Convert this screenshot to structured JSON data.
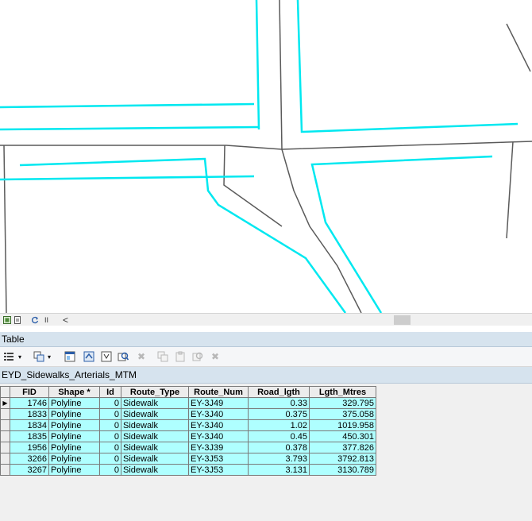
{
  "window": {
    "table_title": "Table",
    "tab_label": "EYD_Sidewalks_Arterials_MTM"
  },
  "map_bar": {
    "icons": [
      "layout-view-icon",
      "data-view-icon",
      "refresh-icon",
      "pause-icon",
      "scroll-left-icon"
    ],
    "pause_glyph": "II",
    "scroll_left_glyph": "<"
  },
  "toolbar": {
    "icons": [
      "table-options-icon",
      "related-tables-icon",
      "select-by-attributes-icon",
      "switch-selection-icon",
      "clear-selection-icon",
      "zoom-to-selected-icon",
      "delete-selected-icon",
      "copy-icon",
      "paste-icon",
      "zoom-icon",
      "delete-icon"
    ]
  },
  "colors": {
    "sidewalk": "#00e8f0",
    "road": "#555555",
    "row_bg": "#afffff",
    "header_bg": "#d6e3ee"
  },
  "table": {
    "columns": [
      "FID",
      "Shape *",
      "Id",
      "Route_Type",
      "Route_Num",
      "Road_lgth",
      "Lgth_Mtres"
    ],
    "rows": [
      [
        "1746",
        "Polyline",
        "0",
        "Sidewalk",
        "EY-3J49",
        "0.33",
        "329.795"
      ],
      [
        "1833",
        "Polyline",
        "0",
        "Sidewalk",
        "EY-3J40",
        "0.375",
        "375.058"
      ],
      [
        "1834",
        "Polyline",
        "0",
        "Sidewalk",
        "EY-3J40",
        "1.02",
        "1019.958"
      ],
      [
        "1835",
        "Polyline",
        "0",
        "Sidewalk",
        "EY-3J40",
        "0.45",
        "450.301"
      ],
      [
        "1956",
        "Polyline",
        "0",
        "Sidewalk",
        "EY-3J39",
        "0.378",
        "377.826"
      ],
      [
        "3266",
        "Polyline",
        "0",
        "Sidewalk",
        "EY-3J53",
        "3.793",
        "3792.813"
      ],
      [
        "3267",
        "Polyline",
        "0",
        "Sidewalk",
        "EY-3J53",
        "3.131",
        "3130.789"
      ]
    ]
  }
}
